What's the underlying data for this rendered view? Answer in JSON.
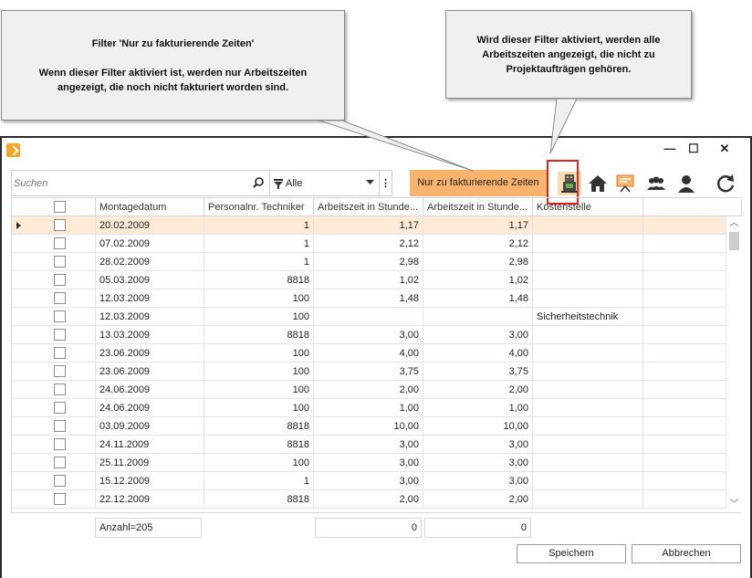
{
  "callouts": {
    "left": {
      "title": "Filter 'Nur zu fakturierende Zeiten'",
      "body": "Wenn dieser Filter aktiviert ist, werden nur Arbeitszeiten angezeigt, die noch nicht fakturiert worden sind."
    },
    "right": {
      "body": "Wird dieser Filter aktiviert, werden alle Arbeitszeiten angezeigt, die nicht zu Projektaufträgen gehören."
    }
  },
  "window": {
    "controls": {
      "minimize": "—",
      "maximize": "☐",
      "close": "✕"
    }
  },
  "toolbar": {
    "search_placeholder": "Suchen",
    "filter_value": "Alle",
    "kebab": "⋮",
    "filter_button_label": "Nur zu fakturierende Zeiten"
  },
  "grid": {
    "columns": [
      "",
      "Montagedatum",
      "Personalnr. Techniker",
      "Arbeitszeit in Stunde...",
      "Arbeitszeit in Stunde...",
      "Kostenstelle"
    ],
    "rows": [
      {
        "date": "20.02.2009",
        "tech": "1",
        "h1": "1,17",
        "h2": "1,17",
        "cost": ""
      },
      {
        "date": "07.02.2009",
        "tech": "1",
        "h1": "2,12",
        "h2": "2,12",
        "cost": ""
      },
      {
        "date": "28.02.2009",
        "tech": "1",
        "h1": "2,98",
        "h2": "2,98",
        "cost": ""
      },
      {
        "date": "05.03.2009",
        "tech": "8818",
        "h1": "1,02",
        "h2": "1,02",
        "cost": ""
      },
      {
        "date": "12.03.2009",
        "tech": "100",
        "h1": "1,48",
        "h2": "1,48",
        "cost": ""
      },
      {
        "date": "12.03.2009",
        "tech": "100",
        "h1": "",
        "h2": "",
        "cost": "Sicherheitstechnik"
      },
      {
        "date": "13.03.2009",
        "tech": "8818",
        "h1": "3,00",
        "h2": "3,00",
        "cost": ""
      },
      {
        "date": "23.06.2009",
        "tech": "100",
        "h1": "4,00",
        "h2": "4,00",
        "cost": ""
      },
      {
        "date": "23.06.2009",
        "tech": "100",
        "h1": "3,75",
        "h2": "3,75",
        "cost": ""
      },
      {
        "date": "24.06.2009",
        "tech": "100",
        "h1": "2,00",
        "h2": "2,00",
        "cost": ""
      },
      {
        "date": "24.06.2009",
        "tech": "100",
        "h1": "1,00",
        "h2": "1,00",
        "cost": ""
      },
      {
        "date": "03.09.2009",
        "tech": "8818",
        "h1": "10,00",
        "h2": "10,00",
        "cost": ""
      },
      {
        "date": "24.11.2009",
        "tech": "8818",
        "h1": "3,00",
        "h2": "3,00",
        "cost": ""
      },
      {
        "date": "25.11.2009",
        "tech": "100",
        "h1": "3,00",
        "h2": "3,00",
        "cost": ""
      },
      {
        "date": "15.12.2009",
        "tech": "1",
        "h1": "3,00",
        "h2": "3,00",
        "cost": ""
      },
      {
        "date": "22.12.2009",
        "tech": "8818",
        "h1": "2,00",
        "h2": "2,00",
        "cost": ""
      }
    ],
    "footer": {
      "count": "Anzahl=205",
      "sum1": "0",
      "sum2": "0"
    }
  },
  "buttons": {
    "save": "Speichern",
    "cancel": "Abbrechen"
  },
  "colors": {
    "accent": "#f9b36c",
    "selected_row": "#fdebd8",
    "highlight": "#e2231a"
  }
}
